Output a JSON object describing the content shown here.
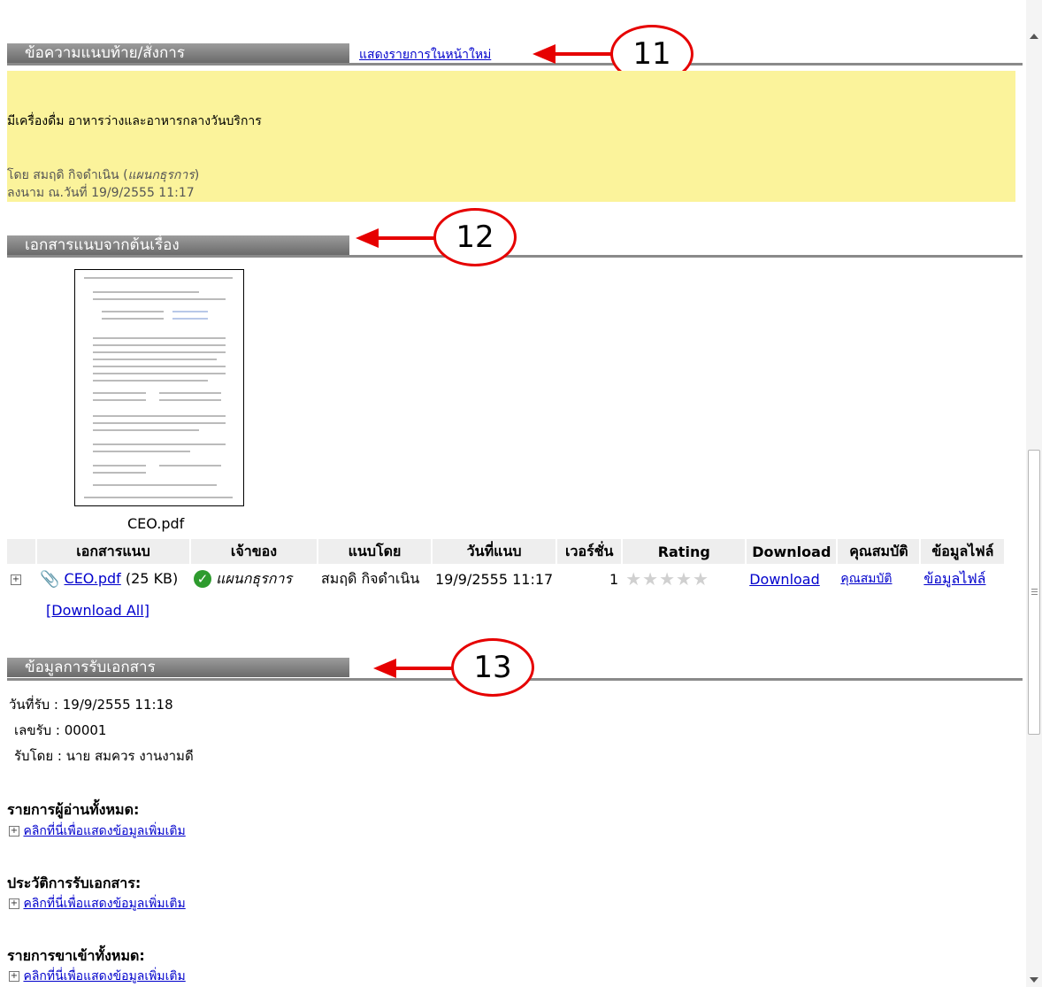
{
  "section_note": {
    "header": "ข้อความแนบท้าย/สั่งการ",
    "link": "แสดงรายการในหน้าใหม่",
    "callout": "11",
    "message": "มีเครื่องดื่ม อาหารว่างและอาหารกลางวันบริการ",
    "by_label": "โดย สมฤดิ กิจดำเนิน (",
    "by_dept": "แผนกธุรการ",
    "by_close": ")",
    "signed": "ลงนาม ณ.วันที่ 19/9/2555 11:17"
  },
  "section_attach": {
    "header": "เอกสารแนบจากต้นเรื่อง",
    "callout": "12",
    "thumb_caption": "CEO.pdf",
    "columns": [
      "เอกสารแนบ",
      "เจ้าของ",
      "แนบโดย",
      "วันที่แนบ",
      "เวอร์ชั่น",
      "Rating",
      "Download",
      "คุณสมบัติ",
      "ข้อมูลไฟล์"
    ],
    "row": {
      "file": "CEO.pdf",
      "size": "(25 KB)",
      "owner": "แผนกธุรการ",
      "by": "สมฤดิ กิจดำเนิน",
      "date": "19/9/2555 11:17",
      "version": "1",
      "stars": "★★★★★",
      "download": "Download",
      "properties": "คุณสมบัติ",
      "fileinfo": "ข้อมูลไฟล์"
    },
    "download_all": "[Download All]"
  },
  "section_receive": {
    "header": "ข้อมูลการรับเอกสาร",
    "callout": "13",
    "date": "วันที่รับ : 19/9/2555 11:18",
    "number": "เลขรับ : 00001",
    "by": "รับโดย : นาย สมควร งานงามดี"
  },
  "lists": [
    {
      "title": "รายการผู้อ่านทั้งหมด:",
      "link": "คลิกที่นี่เพื่อแสดงข้อมูลเพิ่มเติม"
    },
    {
      "title": "ประวัติการรับเอกสาร:",
      "link": "คลิกที่นี่เพื่อแสดงข้อมูลเพิ่มเติม"
    },
    {
      "title": "รายการขาเข้าทั้งหมด:",
      "link": "คลิกที่นี่เพื่อแสดงข้อมูลเพิ่มเติม"
    }
  ],
  "colors": {
    "callout": "#e60000",
    "note_bg": "#fbf39b",
    "header_bar": "#7a7a7a",
    "link": "#0000cc"
  }
}
